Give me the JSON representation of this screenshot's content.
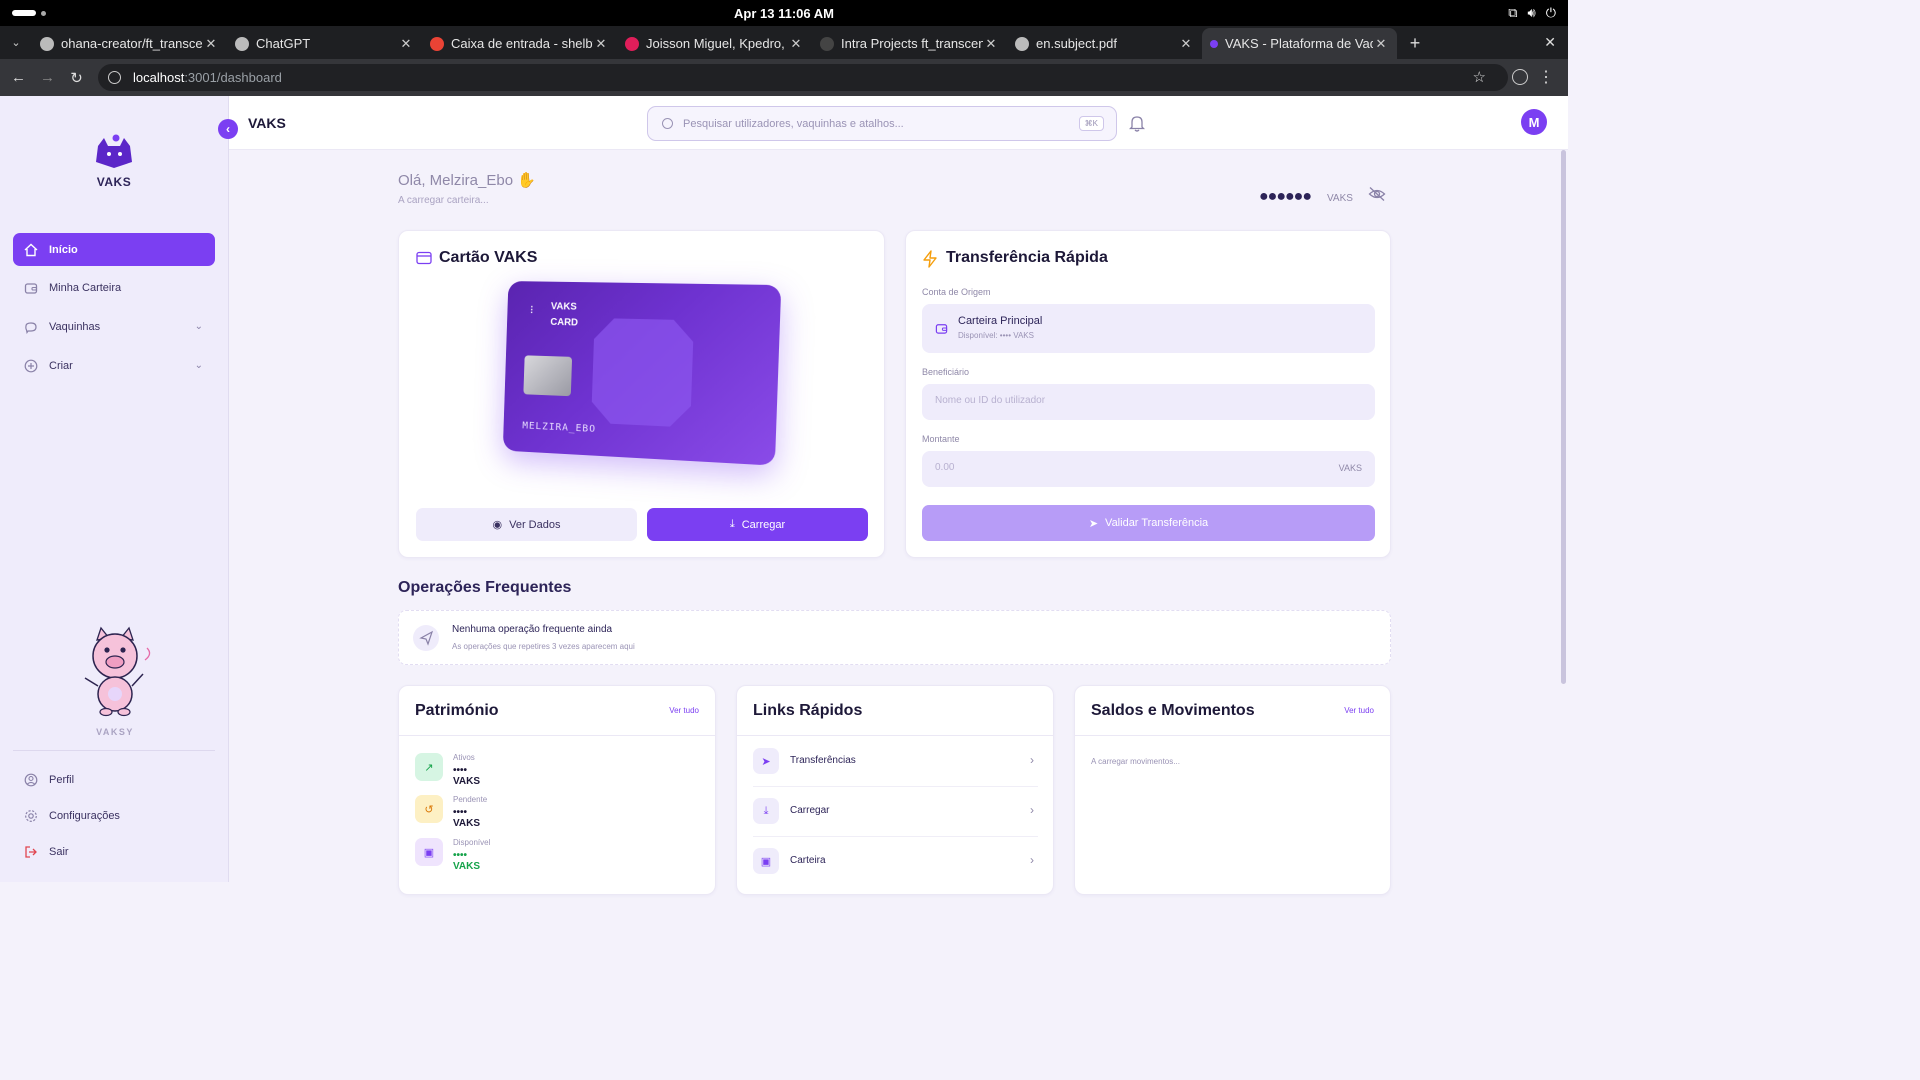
{
  "os": {
    "datetime": "Apr 13  11:06 AM"
  },
  "browser": {
    "tabs": [
      {
        "title": "ohana-creator/ft_transce"
      },
      {
        "title": "ChatGPT"
      },
      {
        "title": "Caixa de entrada - shelby"
      },
      {
        "title": "Joisson Miguel, Kpedro, C"
      },
      {
        "title": "Intra Projects ft_transcen"
      },
      {
        "title": "en.subject.pdf"
      },
      {
        "title": "VAKS - Plataforma de Vaq"
      }
    ],
    "url_host": "localhost",
    "url_path": ":3001/dashboard"
  },
  "sidebar": {
    "brand": "VAKS",
    "nav": [
      {
        "label": "Início"
      },
      {
        "label": "Minha Carteira"
      },
      {
        "label": "Vaquinhas"
      },
      {
        "label": "Criar"
      }
    ],
    "mascot_name": "VAKSY",
    "bottom": [
      {
        "label": "Perfil"
      },
      {
        "label": "Configurações"
      },
      {
        "label": "Sair"
      }
    ]
  },
  "header": {
    "title": "VAKS",
    "search_placeholder": "Pesquisar utilizadores, vaquinhas e atalhos...",
    "shortcut": "⌘K",
    "avatar_initial": "M"
  },
  "greeting": {
    "text": "Olá, Melzira_Ebo",
    "subtitle": "A carregar carteira...",
    "balance_masked": "●●●●●●",
    "balance_unit": "VAKS"
  },
  "card_panel": {
    "title": "Cartão VAKS",
    "card_brand_line1": "VAKS",
    "card_brand_line2": "CARD",
    "card_holder": "MELZIRA_EBO",
    "view_button": "Ver Dados",
    "load_button": "Carregar"
  },
  "transfer": {
    "title": "Transferência Rápida",
    "origin_label": "Conta de Origem",
    "origin_name": "Carteira Principal",
    "origin_available": "Disponível: •••• VAKS",
    "beneficiary_label": "Beneficiário",
    "beneficiary_placeholder": "Nome ou ID do utilizador",
    "amount_label": "Montante",
    "amount_placeholder": "0.00",
    "amount_unit": "VAKS",
    "submit": "Validar Transferência"
  },
  "frequent": {
    "title": "Operações Frequentes",
    "empty_title": "Nenhuma operação frequente ainda",
    "empty_subtitle": "As operações que repetires 3 vezes aparecem aqui"
  },
  "assets": {
    "title": "Património",
    "link": "Ver tudo",
    "rows": [
      {
        "label": "Ativos",
        "value": "•••• VAKS",
        "color": "#16a34a"
      },
      {
        "label": "Pendente",
        "value": "•••• VAKS",
        "color": "#1d1838"
      },
      {
        "label": "Disponível",
        "value": "•••• VAKS",
        "color": "#16a34a"
      }
    ]
  },
  "quick_links": {
    "title": "Links Rápidos",
    "items": [
      {
        "label": "Transferências"
      },
      {
        "label": "Carregar"
      },
      {
        "label": "Carteira"
      }
    ]
  },
  "movements": {
    "title": "Saldos e Movimentos",
    "link": "Ver tudo",
    "loading": "A carregar movimentos..."
  },
  "colors": {
    "accent": "#7b3ff2",
    "sidebar_bg": "#efecfb",
    "page_bg": "#f4f2fb"
  }
}
